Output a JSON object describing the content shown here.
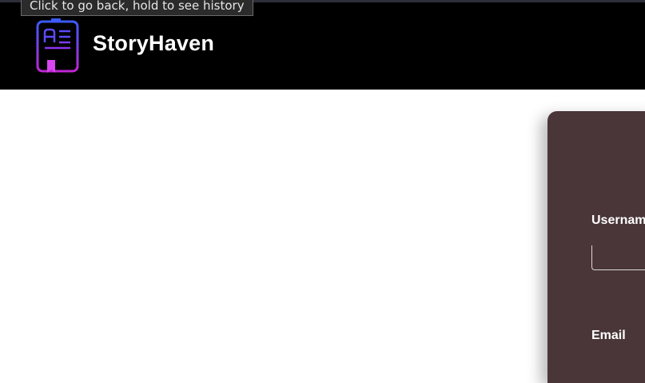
{
  "browser": {
    "tooltip_text": "Click to go back, hold to see history"
  },
  "header": {
    "brand_name": "StoryHaven",
    "logo_icon": "book-icon",
    "background": "#000000"
  },
  "login_form": {
    "username_label": "Usernam",
    "email_label": "Email",
    "username_value": "",
    "card_color": "#4a3638"
  }
}
